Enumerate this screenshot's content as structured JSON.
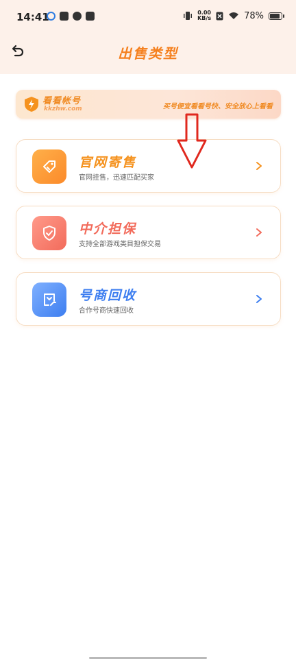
{
  "status_bar": {
    "time": "14:41",
    "net_speed_value": "0.00",
    "net_speed_unit": "KB/s",
    "battery": "78%"
  },
  "nav": {
    "title": "出售类型"
  },
  "banner": {
    "brand_name": "看看帐号",
    "brand_domain": "kkzhw.com",
    "slogan": "买号便宜看看号快、安全放心上看看"
  },
  "options": [
    {
      "title": "官网寄售",
      "subtitle": "官网挂售，迅速匹配买家",
      "color": "#f5921e"
    },
    {
      "title": "中介担保",
      "subtitle": "支持全部游戏类目担保交易",
      "color": "#f26b5b"
    },
    {
      "title": "号商回收",
      "subtitle": "合作号商快速回收",
      "color": "#3d7ef0"
    }
  ],
  "colors": {
    "accent": "#f5801e",
    "arrow": "#e0281e",
    "page_bg": "#ffffff",
    "header_bg": "#fdf1ea"
  },
  "icons": [
    "back-icon",
    "price-tag-icon",
    "shield-check-icon",
    "recycle-hand-icon",
    "chevron-right-icon",
    "red-down-arrow"
  ]
}
